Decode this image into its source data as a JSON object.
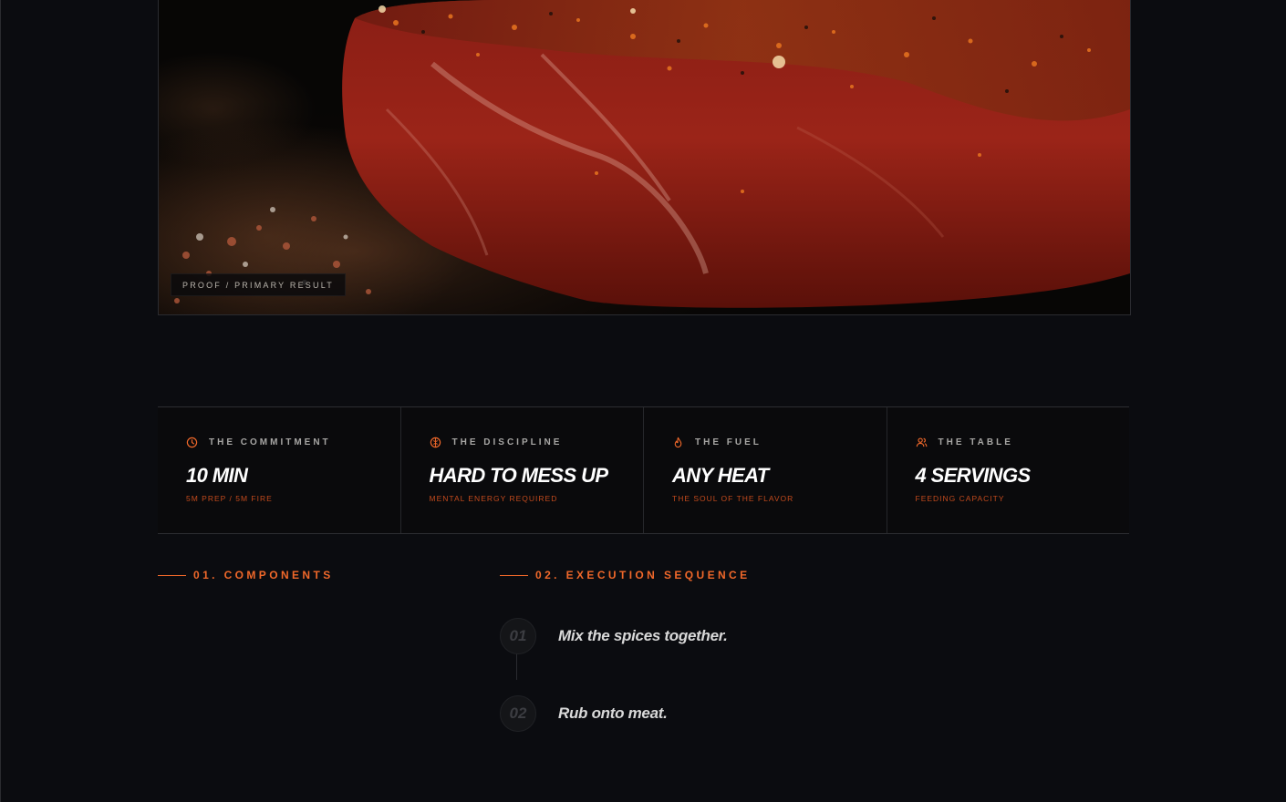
{
  "hero": {
    "caption": "PROOF / PRIMARY RESULT",
    "image_subject": "seasoned raw steak covered in spice rub on dark surface"
  },
  "stats": [
    {
      "icon": "clock-icon",
      "label": "THE COMMITMENT",
      "value": "10 MIN",
      "sub": "5M PREP / 5M FIRE"
    },
    {
      "icon": "brain-icon",
      "label": "THE DISCIPLINE",
      "value": "HARD TO MESS UP",
      "sub": "MENTAL ENERGY REQUIRED"
    },
    {
      "icon": "flame-icon",
      "label": "THE FUEL",
      "value": "ANY HEAT",
      "sub": "THE SOUL OF THE FLAVOR"
    },
    {
      "icon": "users-icon",
      "label": "THE TABLE",
      "value": "4 SERVINGS",
      "sub": "FEEDING CAPACITY"
    }
  ],
  "sections": {
    "components": "01. COMPONENTS",
    "execution": "02. EXECUTION SEQUENCE"
  },
  "steps": [
    {
      "num": "01",
      "text": "Mix the spices together."
    },
    {
      "num": "02",
      "text": "Rub onto meat."
    }
  ],
  "colors": {
    "accent": "#f0682a",
    "sub_accent": "#c24a1d",
    "background": "#0b0c10"
  }
}
